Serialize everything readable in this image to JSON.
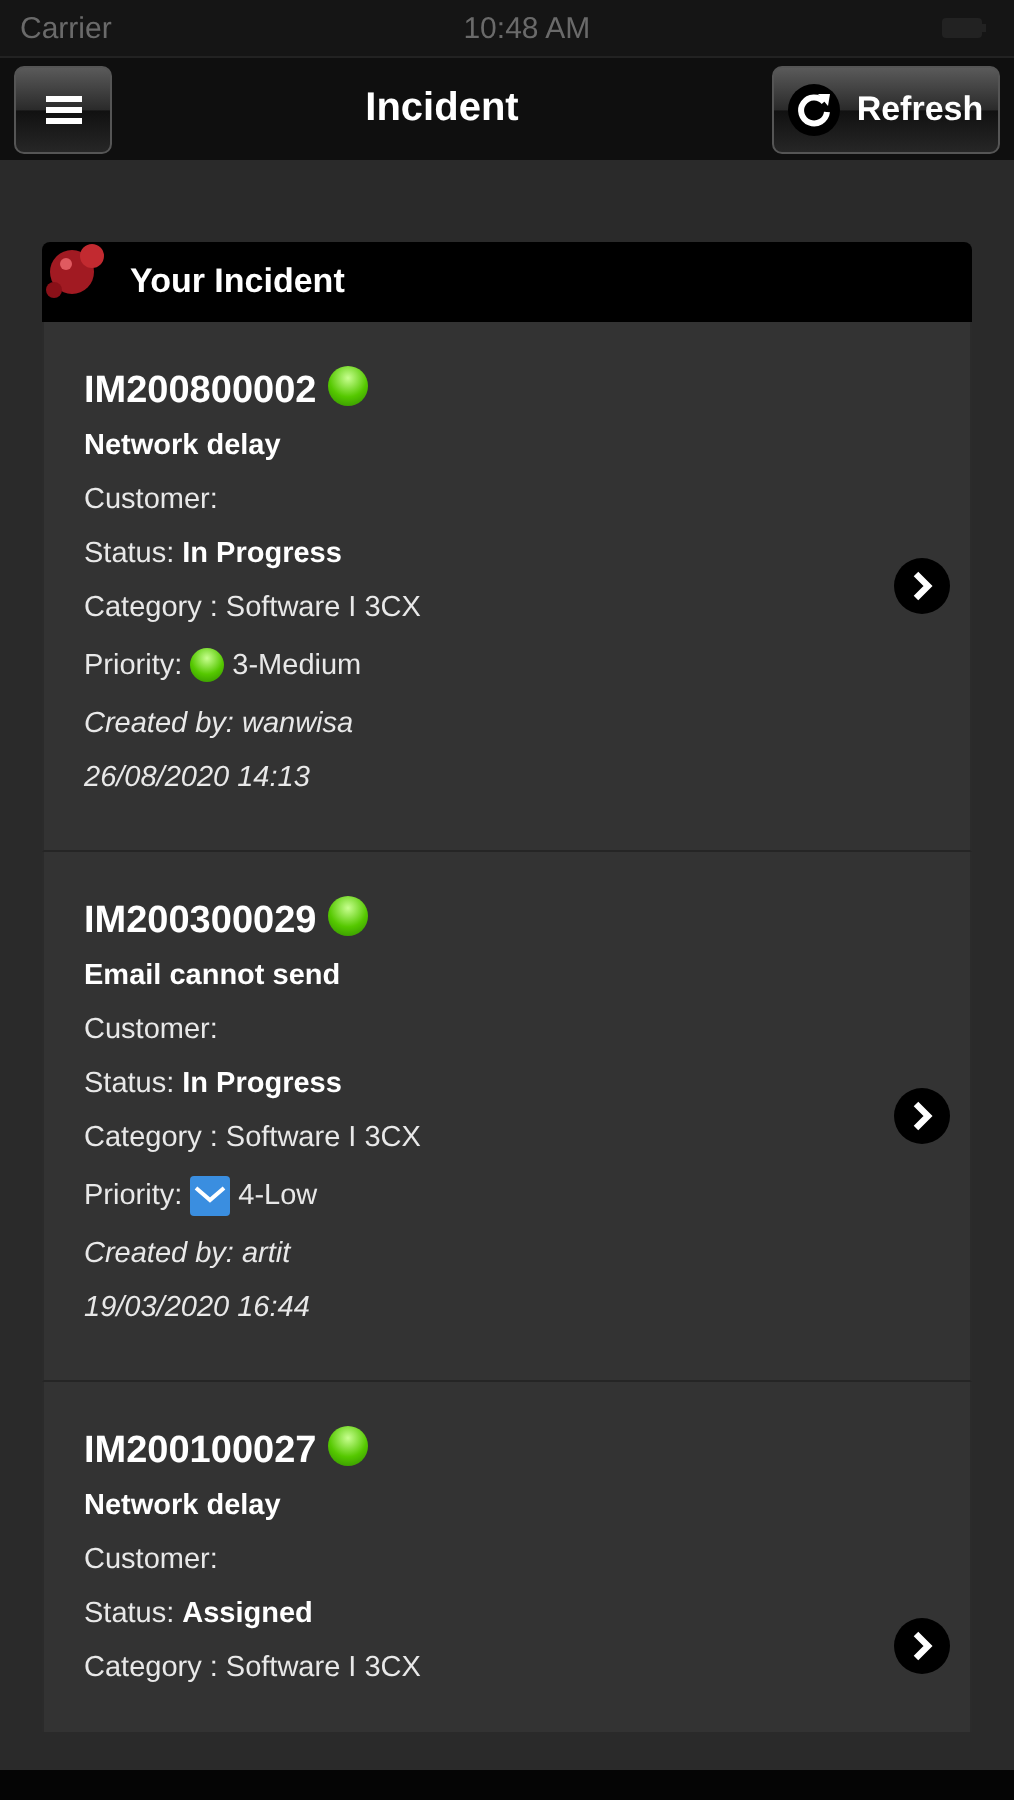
{
  "status_bar": {
    "carrier": "Carrier",
    "time": "10:48 AM"
  },
  "nav": {
    "title": "Incident",
    "refresh_label": "Refresh"
  },
  "section": {
    "title": "Your Incident"
  },
  "incidents": [
    {
      "id": "IM200800002",
      "summary": "Network delay",
      "customer_label": "Customer:",
      "status_label": "Status:",
      "status": "In Progress",
      "category": "Category : Software I 3CX",
      "priority_label": "Priority:",
      "priority": {
        "kind": "ball",
        "text": "3-Medium"
      },
      "created_by": "Created by: wanwisa",
      "date": "26/08/2020 14:13"
    },
    {
      "id": "IM200300029",
      "summary": "Email cannot send",
      "customer_label": "Customer:",
      "status_label": "Status:",
      "status": "In Progress",
      "category": "Category : Software I 3CX",
      "priority_label": "Priority:",
      "priority": {
        "kind": "envelope",
        "text": "4-Low"
      },
      "created_by": "Created by: artit",
      "date": "19/03/2020 16:44"
    },
    {
      "id": "IM200100027",
      "summary": "Network delay",
      "customer_label": "Customer:",
      "status_label": "Status:",
      "status": "Assigned",
      "category": "Category : Software I 3CX"
    }
  ]
}
